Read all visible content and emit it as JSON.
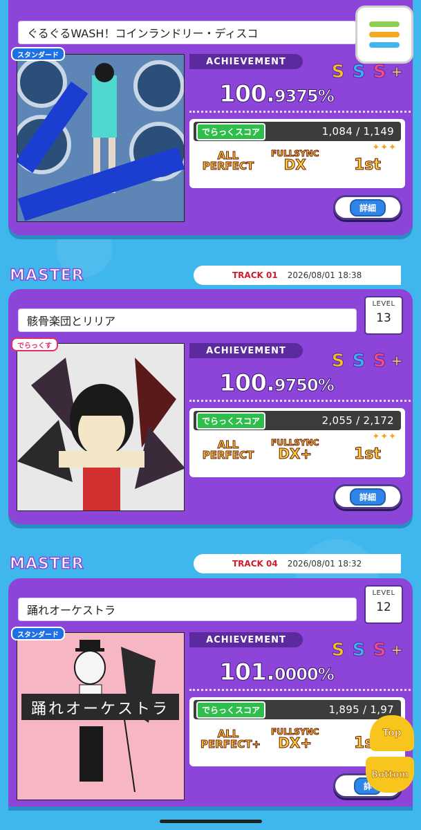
{
  "menu": {
    "colors": [
      "#8fd14f",
      "#f5a623",
      "#3fb6ec"
    ]
  },
  "entries": [
    {
      "title": "ぐるぐるWASH！コインランドリー・ディスコ",
      "tag": "スタンダード",
      "achievement_label": "ACHIEVEMENT",
      "score_int": "100.",
      "score_frac": "9375%",
      "rank": [
        "S",
        "S",
        "S",
        "+"
      ],
      "dx_label": "でらっくスコア",
      "dx_score": "1,084 / 1,149",
      "stars": "✦✦✦",
      "combo": "ALL PERFECT",
      "sync_top": "FULLSYNC",
      "sync_bottom": "DX",
      "place": "1st",
      "detail_button": "詳細"
    },
    {
      "difficulty": "MASTER",
      "track": "TRACK 01",
      "date": "2026/08/01 18:38",
      "title": "骸骨楽団とリリア",
      "level_label": "LEVEL",
      "level": "13",
      "tag": "でらっくす",
      "achievement_label": "ACHIEVEMENT",
      "score_int": "100.",
      "score_frac": "9750%",
      "rank": [
        "S",
        "S",
        "S",
        "+"
      ],
      "dx_label": "でらっくスコア",
      "dx_score": "2,055 / 2,172",
      "stars": "✦✦✦",
      "combo": "ALL PERFECT",
      "sync_top": "FULLSYNC",
      "sync_bottom": "DX+",
      "place": "1st",
      "detail_button": "詳細"
    },
    {
      "difficulty": "MASTER",
      "track": "TRACK 04",
      "date": "2026/08/01 18:32",
      "title": "踊れオーケストラ",
      "level_label": "LEVEL",
      "level": "12",
      "tag": "スタンダード",
      "jacket_text": "踊れオーケストラ",
      "achievement_label": "ACHIEVEMENT",
      "score_int": "101.",
      "score_frac": "0000%",
      "rank": [
        "S",
        "S",
        "S",
        "+"
      ],
      "dx_label": "でらっくスコア",
      "dx_score": "1,895 / 1,97",
      "stars": "✦✦",
      "combo": "ALL PERFECT+",
      "sync_top": "FULLSYNC",
      "sync_bottom": "DX+",
      "place": "1s",
      "detail_button": "詳"
    }
  ],
  "float": {
    "top_label": "Top",
    "bottom_label": "Bottom"
  }
}
